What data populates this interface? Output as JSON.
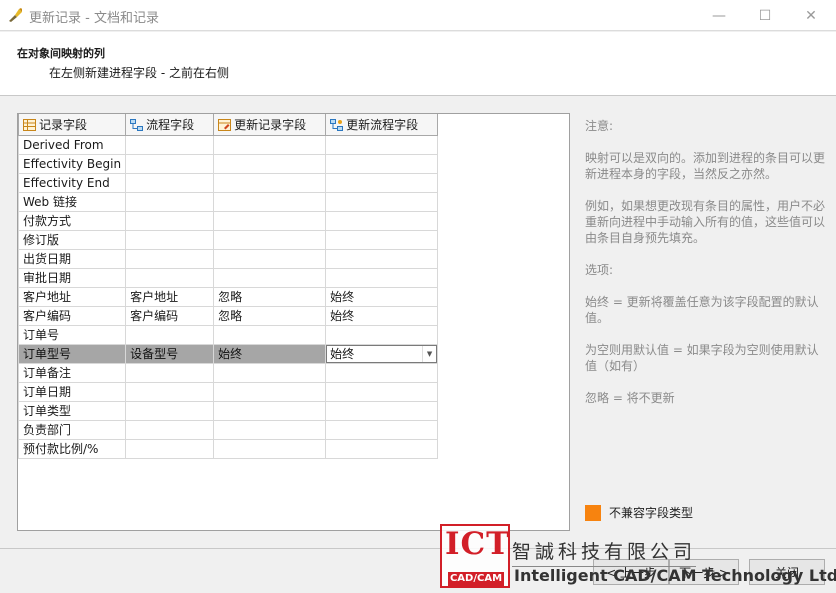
{
  "window": {
    "title": "更新记录 - 文档和记录",
    "min_glyph": "—",
    "max_glyph": "☐",
    "close_glyph": "✕"
  },
  "header": {
    "title": "在对象间映射的列",
    "subtitle": "在左侧新建进程字段 - 之前在右侧"
  },
  "grid": {
    "columns": [
      {
        "label": "记录字段",
        "icon": "record-field-icon"
      },
      {
        "label": "流程字段",
        "icon": "process-field-icon"
      },
      {
        "label": "更新记录字段",
        "icon": "update-record-field-icon"
      },
      {
        "label": "更新流程字段",
        "icon": "update-process-field-icon"
      }
    ],
    "rows": [
      [
        "Derived From",
        "",
        "",
        ""
      ],
      [
        "Effectivity Begin",
        "",
        "",
        ""
      ],
      [
        "Effectivity End",
        "",
        "",
        ""
      ],
      [
        "Web 链接",
        "",
        "",
        ""
      ],
      [
        "付款方式",
        "",
        "",
        ""
      ],
      [
        "修订版",
        "",
        "",
        ""
      ],
      [
        "出货日期",
        "",
        "",
        ""
      ],
      [
        "审批日期",
        "",
        "",
        ""
      ],
      [
        "客户地址",
        "客户地址",
        "忽略",
        "始终"
      ],
      [
        "客户编码",
        "客户编码",
        "忽略",
        "始终"
      ],
      [
        "订单号",
        "",
        "",
        ""
      ],
      [
        "订单型号",
        "设备型号",
        "始终",
        "始终"
      ],
      [
        "订单备注",
        "",
        "",
        ""
      ],
      [
        "订单日期",
        "",
        "",
        ""
      ],
      [
        "订单类型",
        "",
        "",
        ""
      ],
      [
        "负责部门",
        "",
        "",
        ""
      ],
      [
        "预付款比例/%",
        "",
        "",
        ""
      ]
    ],
    "selected_row": 11
  },
  "notes": {
    "heading": "注意:",
    "p1": "映射可以是双向的。添加到进程的条目可以更新进程本身的字段，当然反之亦然。",
    "p2": "例如，如果想更改现有条目的属性，用户不必重新向进程中手动输入所有的值，这些值可以由条目自身预先填充。",
    "options_heading": "选项:",
    "opt1": "始终 = 更新将覆盖任意为该字段配置的默认值。",
    "opt2": "为空则用默认值 = 如果字段为空则使用默认值（如有）",
    "opt3": "忽略 = 将不更新"
  },
  "legend": {
    "label": "不兼容字段类型",
    "color": "#f7830f"
  },
  "buttons": {
    "prev": "< 上一步",
    "next": "下一步 >",
    "close": "关闭"
  },
  "watermark": {
    "logo": "ICT",
    "logo_sub": "CAD/CAM",
    "cn": "智誠科技有限公司",
    "en": "Intelligent CAD/CAM Technology Ltd."
  }
}
